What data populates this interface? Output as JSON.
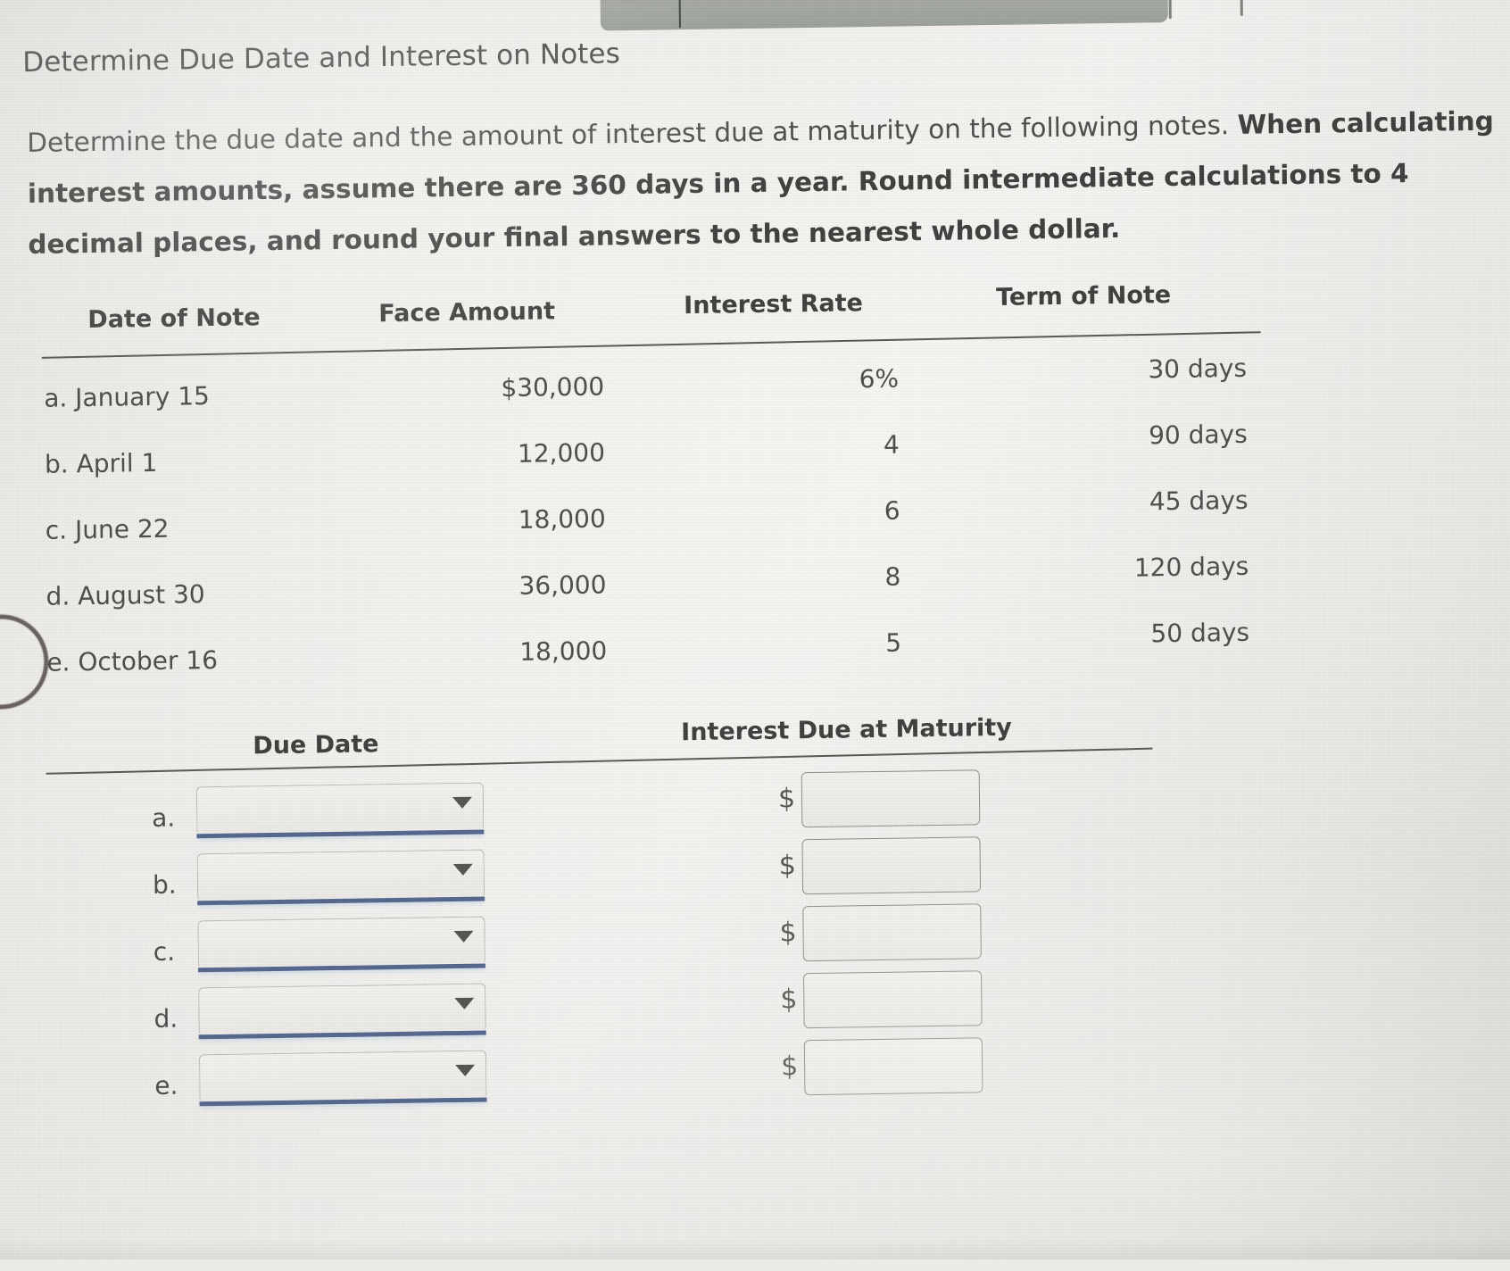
{
  "page_title": "Determine Due Date and Interest on Notes",
  "instructions": {
    "normal_text": "Determine the due date and the amount of interest due at maturity on the following notes. ",
    "bold_text": "When calculating interest amounts, assume there are 360 days in a year. Round intermediate calculations to 4 decimal places, and round your final answers to the nearest whole dollar."
  },
  "notes_table": {
    "headers": {
      "date_of_note": "Date of Note",
      "face_amount": "Face Amount",
      "interest_rate": "Interest Rate",
      "term_of_note": "Term of Note"
    },
    "rows": [
      {
        "date": "a. January 15",
        "face": "$30,000",
        "rate": "6%",
        "term": "30 days"
      },
      {
        "date": "b. April 1",
        "face": "12,000",
        "rate": "4",
        "term": "90 days"
      },
      {
        "date": "c. June 22",
        "face": "18,000",
        "rate": "6",
        "term": "45 days"
      },
      {
        "date": "d. August 30",
        "face": "36,000",
        "rate": "8",
        "term": "120 days"
      },
      {
        "date": "e. October 16",
        "face": "18,000",
        "rate": "5",
        "term": "50 days"
      }
    ]
  },
  "answer_table": {
    "headers": {
      "due_date": "Due Date",
      "interest_due": "Interest Due at Maturity"
    },
    "rows": [
      {
        "label": "a.",
        "due_date_value": "",
        "due_date_placeholder": "",
        "dollar_sign": "$",
        "interest_value": ""
      },
      {
        "label": "b.",
        "due_date_value": "",
        "due_date_placeholder": "",
        "dollar_sign": "$",
        "interest_value": ""
      },
      {
        "label": "c.",
        "due_date_value": "",
        "due_date_placeholder": "",
        "dollar_sign": "$",
        "interest_value": ""
      },
      {
        "label": "d.",
        "due_date_value": "",
        "due_date_placeholder": "",
        "dollar_sign": "$",
        "interest_value": ""
      },
      {
        "label": "e.",
        "due_date_value": "",
        "due_date_placeholder": "",
        "dollar_sign": "$",
        "interest_value": ""
      }
    ]
  },
  "icons": {
    "dropdown_arrow": "chevron-down-icon",
    "minimize_button": "minimize-icon"
  },
  "colors": {
    "page_background": "#efedea",
    "text": "#4a4c49",
    "heading": "#3b3d3a",
    "rule": "#54564f",
    "select_underline": "#53658c",
    "input_border": "#8d8d87",
    "browser_chrome": "#a4a8a1"
  }
}
